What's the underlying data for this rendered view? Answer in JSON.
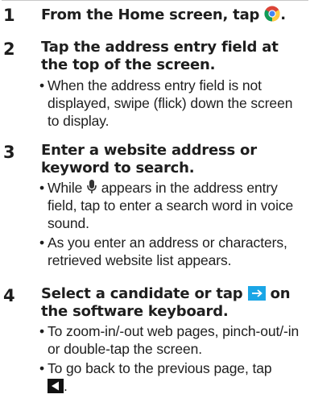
{
  "steps": [
    {
      "num": "1",
      "title_pre": "From the Home screen, tap ",
      "title_post": ".",
      "icon": "chrome-icon"
    },
    {
      "num": "2",
      "title": "Tap the address entry field at the top of the screen.",
      "bullets": [
        "When the address entry field is not displayed, swipe (flick) down the screen to display."
      ]
    },
    {
      "num": "3",
      "title": "Enter a website address or keyword to search.",
      "bullet1_pre": "While ",
      "bullet1_post": " appears in the address entry field, tap to enter a search word in voice sound.",
      "bullet1_icon": "microphone-icon",
      "bullet2": "As you enter an address or characters, retrieved website list appears."
    },
    {
      "num": "4",
      "title_pre": "Select a candidate or tap ",
      "title_post": " on the software keyboard.",
      "title_icon": "arrow-right-key-icon",
      "bullet1": "To zoom-in/-out web pages, pinch-out/-in or double-tap the screen.",
      "bullet2_pre": "To go back to the previous page, tap ",
      "bullet2_post": ".",
      "bullet2_icon": "back-icon"
    }
  ],
  "colors": {
    "text": "#1e1e1e",
    "accent_blue": "#1aa6e6",
    "rule": "#c8c8c8"
  }
}
